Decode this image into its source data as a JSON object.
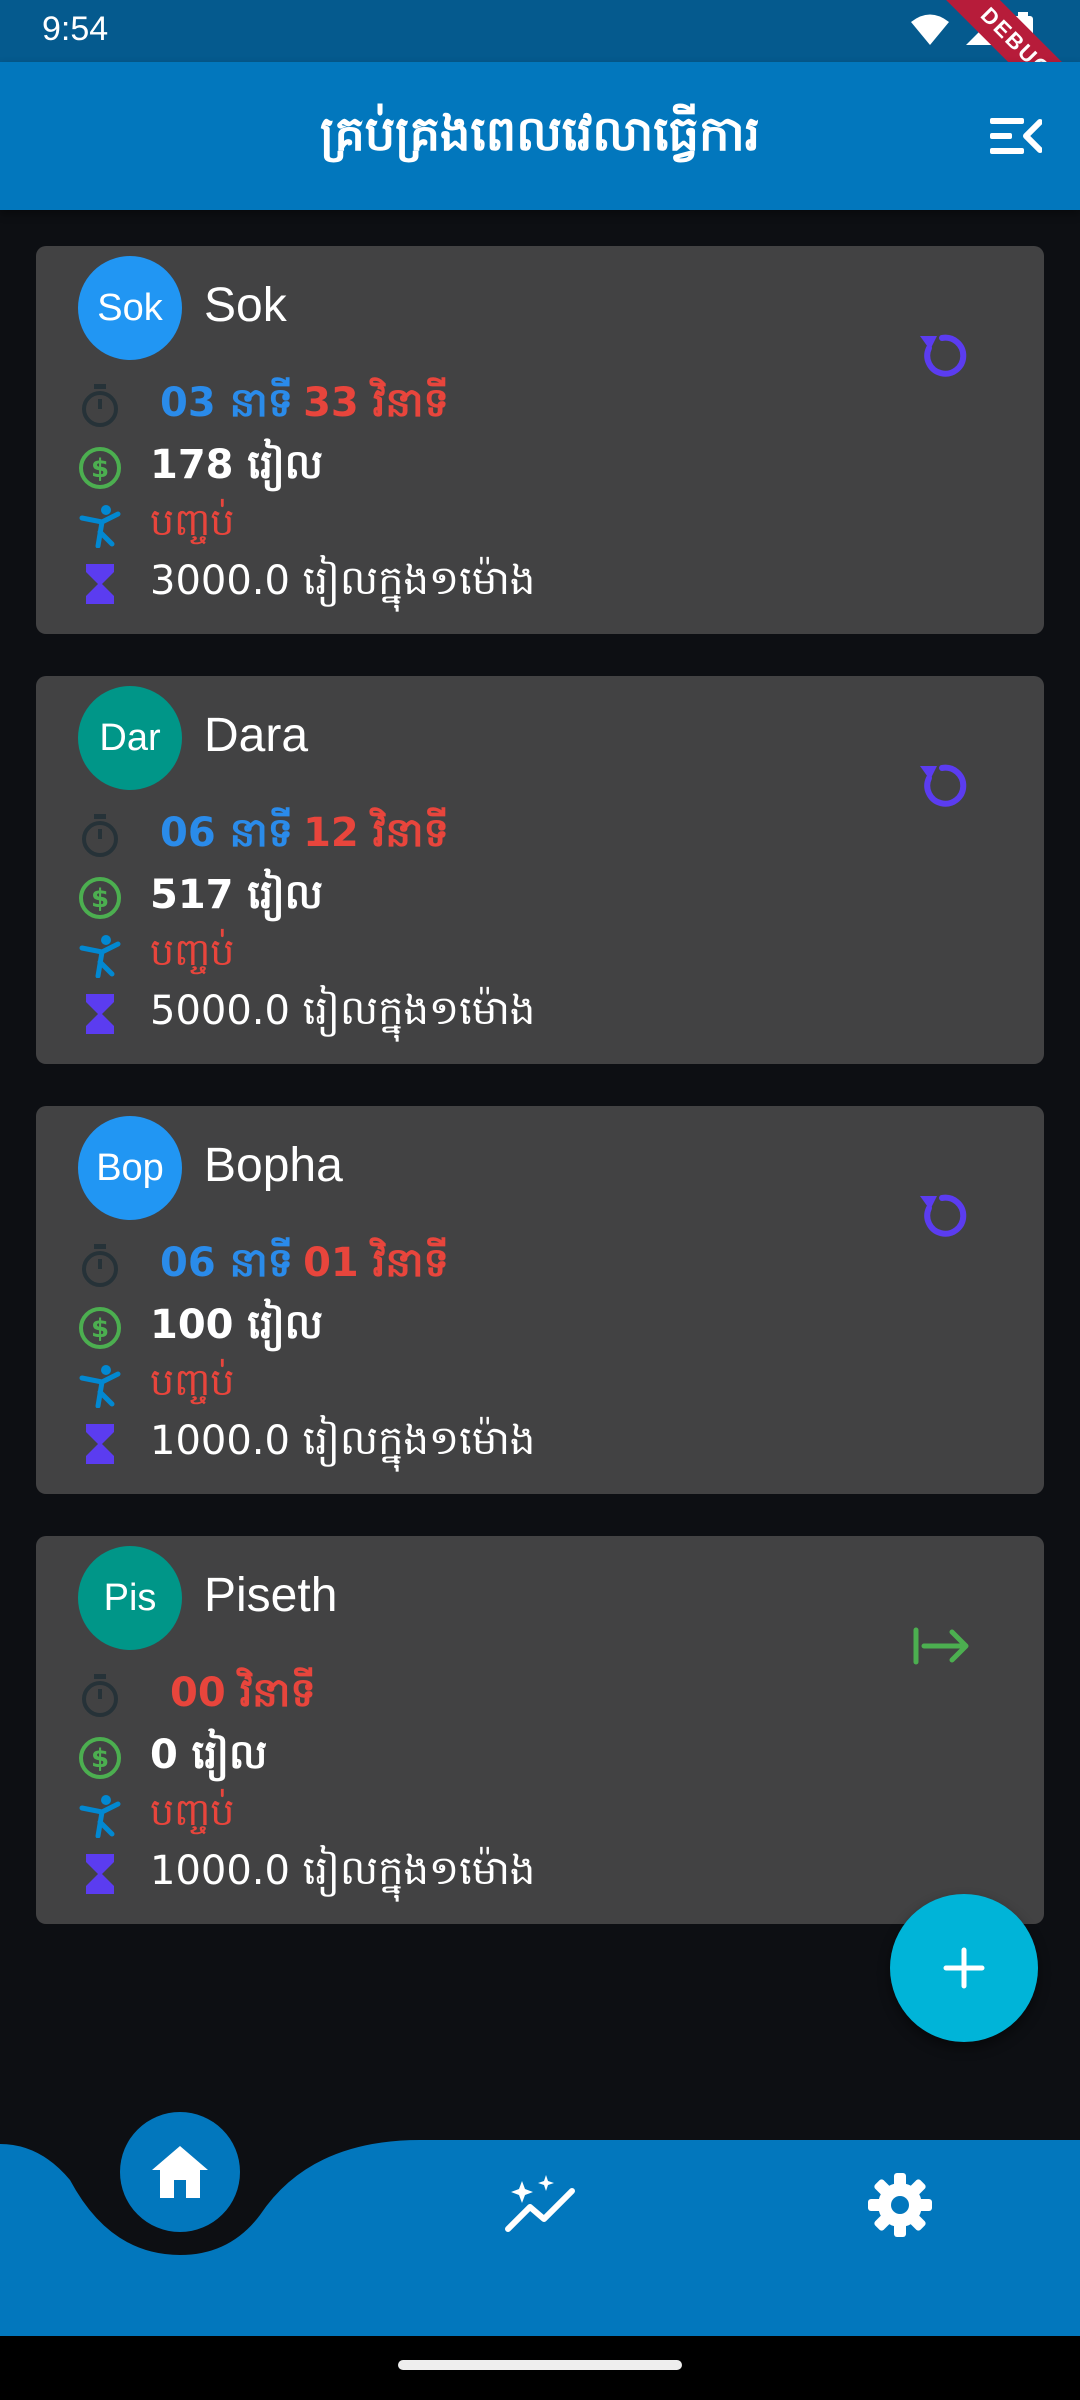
{
  "status_bar": {
    "time": "9:54",
    "debug_label": "DEBUG"
  },
  "app_bar": {
    "title": "គ្រប់គ្រងពេលវេលាធ្វើការ",
    "menu_icon": "menu-collapse-icon"
  },
  "colors": {
    "app_bar": "#0277bd",
    "card": "#424243",
    "minutes": "#2a8bea",
    "seconds": "#e8453c",
    "status": "#e8453c",
    "fab": "#00b4d8",
    "reset_icon": "#5b3cf0",
    "start_icon": "#4caf50"
  },
  "workers": [
    {
      "avatar": "Sok",
      "avatar_color": "#2196f3",
      "name": "Sok",
      "minutes": "03 នាទី",
      "seconds": "33 វិនាទី",
      "earned": "178 រៀល",
      "status": "បញ្ចប់",
      "rate": "3000.0 រៀលក្នុង១ម៉ោង",
      "action_icon": "refresh-icon"
    },
    {
      "avatar": "Dar",
      "avatar_color": "#009688",
      "name": "Dara",
      "minutes": "06 នាទី",
      "seconds": "12 វិនាទី",
      "earned": "517 រៀល",
      "status": "បញ្ចប់",
      "rate": "5000.0 រៀលក្នុង១ម៉ោង",
      "action_icon": "refresh-icon"
    },
    {
      "avatar": "Bop",
      "avatar_color": "#2196f3",
      "name": "Bopha",
      "minutes": "06 នាទី",
      "seconds": "01 វិនាទី",
      "earned": "100 រៀល",
      "status": "បញ្ចប់",
      "rate": "1000.0 រៀលក្នុង១ម៉ោង",
      "action_icon": "refresh-icon"
    },
    {
      "avatar": "Pis",
      "avatar_color": "#009688",
      "name": "Piseth",
      "minutes": "",
      "seconds": "00 វិនាទី",
      "earned": "0 រៀល",
      "status": "បញ្ចប់",
      "rate": "1000.0 រៀលក្នុង១ម៉ោង",
      "action_icon": "arrow-right-to-line-icon"
    }
  ],
  "fab": {
    "icon": "plus-icon"
  },
  "bottom_nav": {
    "items": [
      "home-icon",
      "insights-icon",
      "settings-icon"
    ],
    "selected": "home-icon"
  }
}
